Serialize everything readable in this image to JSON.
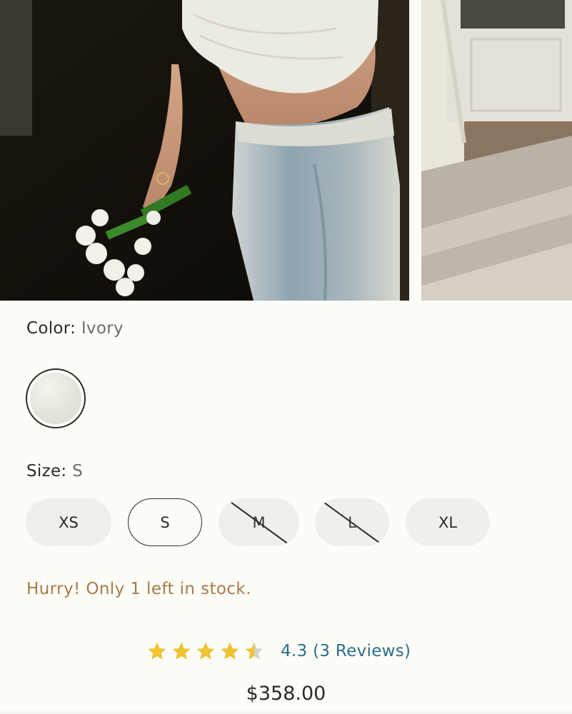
{
  "colors": {
    "background": "#fdfdf8",
    "stock_text": "#a87a48",
    "rating_text": "#2b6e8a",
    "star": "#f1c232"
  },
  "gallery": {
    "images": [
      {
        "icon": "product-photo-model",
        "alt": ""
      },
      {
        "icon": "product-photo-steps",
        "alt": ""
      }
    ]
  },
  "color_option": {
    "label": "Color:",
    "value": "Ivory",
    "swatches": [
      {
        "name": "Ivory",
        "selected": true
      }
    ]
  },
  "size_option": {
    "label": "Size:",
    "value": "S",
    "sizes": [
      {
        "label": "XS",
        "available": true,
        "selected": false
      },
      {
        "label": "S",
        "available": true,
        "selected": true
      },
      {
        "label": "M",
        "available": false,
        "selected": false
      },
      {
        "label": "L",
        "available": false,
        "selected": false
      },
      {
        "label": "XL",
        "available": true,
        "selected": false
      }
    ]
  },
  "stock_message": "Hurry! Only 1 left in stock.",
  "rating": {
    "score": 4.3,
    "text": "4.3 (3 Reviews)",
    "max_stars": 5
  },
  "price": "$358.00"
}
